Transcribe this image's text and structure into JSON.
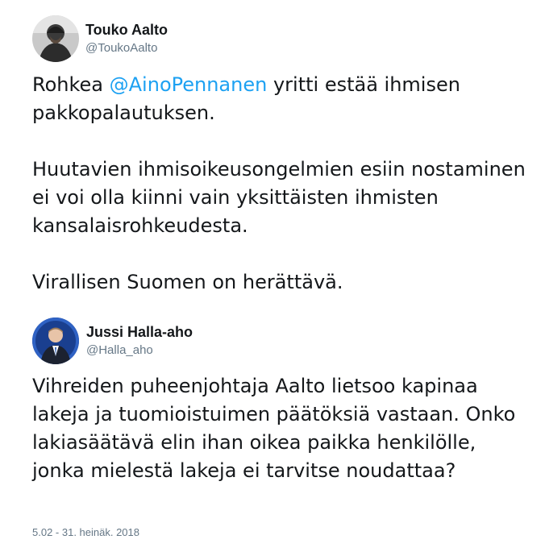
{
  "author": {
    "display_name": "Touko Aalto",
    "handle": "@ToukoAalto",
    "avatar_icon": "user-avatar-icon"
  },
  "tweet": {
    "p1_prefix": "Rohkea ",
    "p1_mention": "@AinoPennanen",
    "p1_suffix": " yritti estää ihmisen pakkopalautuksen.",
    "p2": "Huutavien ihmisoikeusongelmien esiin nostaminen ei voi olla kiinni vain yksittäisten ihmisten kansalaisrohkeudesta.",
    "p3": "Virallisen Suomen on herättävä."
  },
  "quoted": {
    "display_name": "Jussi Halla-aho",
    "handle": "@Halla_aho",
    "avatar_icon": "user-avatar-icon",
    "text": "Vihreiden puheenjohtaja Aalto lietsoo kapinaa lakeja ja tuomioistuimen päätöksiä vastaan. Onko lakiasäätävä elin ihan oikea paikka henkilölle, jonka mielestä lakeja ei tarvitse noudattaa?"
  },
  "timestamp": "5.02 - 31. heinäk. 2018",
  "colors": {
    "link": "#1da1f2",
    "text": "#14171a",
    "secondary": "#657786"
  }
}
